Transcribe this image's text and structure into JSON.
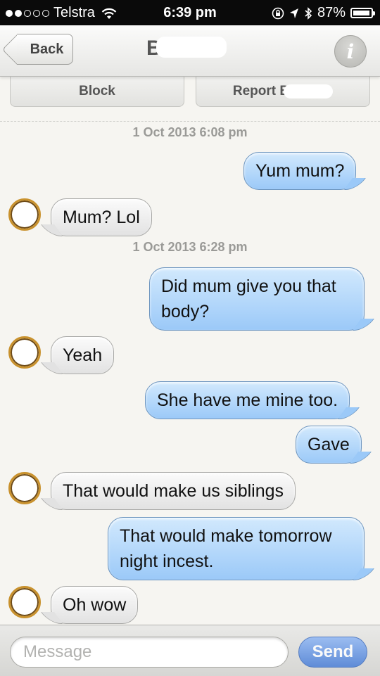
{
  "status_bar": {
    "carrier": "Telstra",
    "time": "6:39 pm",
    "battery": "87%",
    "signal_bars_filled": 2,
    "signal_bars_total": 5
  },
  "nav": {
    "back_label": "Back",
    "title": "B",
    "info_label": "i"
  },
  "actions": {
    "block_label": "Block",
    "report_label": "Report B"
  },
  "messages": [
    {
      "type": "timestamp",
      "text": "1 Oct 2013 6:08 pm"
    },
    {
      "type": "outgoing",
      "text": "Yum mum?"
    },
    {
      "type": "incoming",
      "text": "Mum? Lol"
    },
    {
      "type": "timestamp",
      "text": "1 Oct 2013 6:28 pm"
    },
    {
      "type": "outgoing",
      "lines": [
        "Did mum give you that",
        "body?"
      ]
    },
    {
      "type": "incoming",
      "text": "Yeah"
    },
    {
      "type": "outgoing",
      "text": "She have me mine too."
    },
    {
      "type": "outgoing",
      "text": "Gave"
    },
    {
      "type": "incoming",
      "text": "That would make us siblings"
    },
    {
      "type": "outgoing",
      "lines": [
        "That would make tomorrow",
        "night incest."
      ]
    },
    {
      "type": "incoming",
      "text": "Oh wow"
    }
  ],
  "input": {
    "placeholder": "Message",
    "send_label": "Send"
  },
  "colors": {
    "outgoing_bubble": "#9bc9f8",
    "incoming_bubble": "#e2e2e2",
    "send_button": "#4a7fd8",
    "avatar_ring": "#c9922e"
  },
  "icons": [
    "wifi-icon",
    "rotation-lock-icon",
    "location-arrow-icon",
    "bluetooth-icon",
    "battery-icon",
    "info-icon"
  ]
}
